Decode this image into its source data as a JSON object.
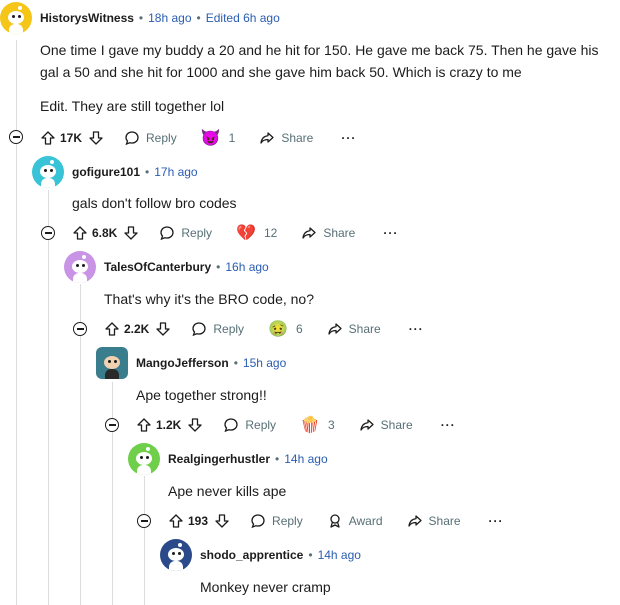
{
  "comments": [
    {
      "username": "HistorysWitness",
      "time": "18h ago",
      "edited": "Edited 6h ago",
      "text_lines": [
        "One time I gave my buddy a 20 and he hit for 150.   He gave me back 75.  Then he gave his",
        "gal a 50 and she hit for 1000 and she gave him back 50.  Which is crazy to me",
        "Edit.  They are still together lol"
      ],
      "votes": "17K",
      "reply_label": "Reply",
      "award_icon": "😈",
      "award_count": "1",
      "share_label": "Share",
      "more_label": "···",
      "avatar_color": "#f5c518"
    },
    {
      "username": "gofigure101",
      "time": "17h ago",
      "text": "gals don't follow bro codes",
      "votes": "6.8K",
      "reply_label": "Reply",
      "award_icon": "💔",
      "award_count": "12",
      "share_label": "Share",
      "more_label": "···",
      "avatar_color": "#38c4d6"
    },
    {
      "username": "TalesOfCanterbury",
      "time": "16h ago",
      "text": "That's why it's the BRO code, no?",
      "votes": "2.2K",
      "reply_label": "Reply",
      "award_icon": "🤢",
      "award_count": "6",
      "share_label": "Share",
      "more_label": "···",
      "avatar_color": "#c993e6"
    },
    {
      "username": "MangoJefferson",
      "time": "15h ago",
      "text": "Ape together strong!!",
      "votes": "1.2K",
      "reply_label": "Reply",
      "award_icon": "🍿",
      "award_count": "3",
      "share_label": "Share",
      "more_label": "···",
      "avatar_color": "#3a7d8c"
    },
    {
      "username": "Realgingerhustler",
      "time": "14h ago",
      "text": "Ape never kills ape",
      "votes": "193",
      "reply_label": "Reply",
      "award_label": "Award",
      "share_label": "Share",
      "more_label": "···",
      "avatar_color": "#6fce4a"
    },
    {
      "username": "shodo_apprentice",
      "time": "14h ago",
      "text": "Monkey never cramp",
      "avatar_color": "#2a4a8a"
    }
  ]
}
